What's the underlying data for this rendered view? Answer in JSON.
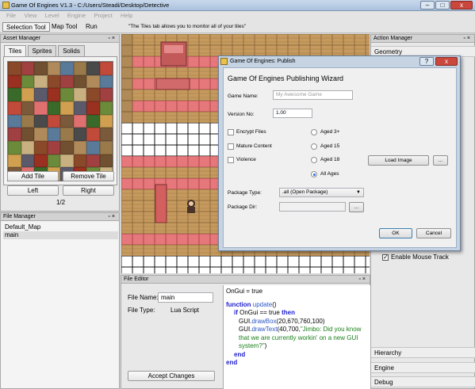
{
  "window": {
    "title": "Game Of Engines V1.3 - C:/Users/Steadi/Desktop/Detective",
    "minimize": "–",
    "maximize": "□",
    "close": "x"
  },
  "menu": [
    "File",
    "View",
    "Level",
    "Engine",
    "Project",
    "Help"
  ],
  "toolbar": {
    "selection_tool": "Selection Tool",
    "map_tool": "Map Tool",
    "run": "Run",
    "hint": "\"The Tiles tab allows you to monitor all of your tiles\""
  },
  "asset_manager": {
    "title": "Asset Manager",
    "tabs": [
      "Tiles",
      "Sprites",
      "Solids"
    ],
    "add_tile": "Add Tile",
    "remove_tile": "Remove Tile",
    "left": "Left",
    "right": "Right",
    "page": "1/2"
  },
  "file_manager": {
    "title": "File Manager",
    "items": [
      "Default_Map",
      "main"
    ]
  },
  "file_editor": {
    "title": "File Editor",
    "file_name_label": "File Name:",
    "file_name_value": "main",
    "file_type_label": "File Type:",
    "file_type_value": "Lua Script",
    "accept": "Accept Changes",
    "code": {
      "l1": "OnGui = true",
      "kw_function": "function",
      "fn_update": "update",
      "l2_tail": "()",
      "kw_if": "if",
      "l3_mid": "OnGui == true",
      "kw_then": "then",
      "gui1": "GUI.",
      "drawbox": "drawBox",
      "drawbox_args": "(20,670,760,100)",
      "gui2": "GUI.",
      "drawtext": "drawText",
      "drawtext_args": "(40,700,",
      "str1": "\"Jimbo: Did you know that we are currently workin' on a new GUI system?\"",
      "close_paren": ")",
      "kw_end1": "end",
      "kw_end2": "end"
    }
  },
  "action_manager": {
    "title": "Action Manager",
    "geometry": "Geometry",
    "enable_mouse_track": "Enable Mouse Track",
    "hierarchy": "Hierarchy",
    "engine": "Engine",
    "debug": "Debug"
  },
  "publish_dialog": {
    "title": "Game Of Engines: Publish",
    "heading": "Game Of Engines Publishing Wizard",
    "game_name_label": "Game Name:",
    "game_name_placeholder": "My Awesome Game",
    "version_label": "Version No:",
    "version_value": "1.00",
    "encrypt_files": "Encrypt Files",
    "mature_content": "Mature Content",
    "violence": "Violence",
    "aged3": "Aged 3+",
    "aged15": "Aged 15",
    "aged18": "Aged 18",
    "all_ages": "All Ages",
    "load_image": "Load Image",
    "ellipsis": "...",
    "package_type_label": "Package Type:",
    "package_type_value": ".all (Open Package)",
    "package_dir_label": "Package Dir:",
    "ok": "OK",
    "cancel": "Cancel",
    "help": "?",
    "close": "x"
  }
}
